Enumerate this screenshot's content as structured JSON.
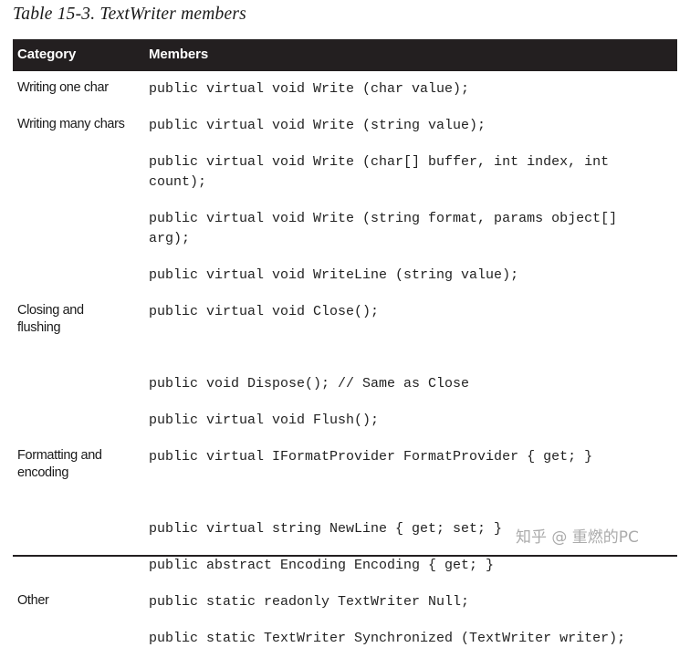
{
  "caption": "Table 15-3. TextWriter members",
  "table": {
    "headers": {
      "category": "Category",
      "members": "Members"
    },
    "rows": [
      {
        "category": "Writing one char",
        "members": "public virtual void Write (char value);"
      },
      {
        "category": "Writing many chars",
        "members": "public virtual void Write (string value);"
      },
      {
        "category": "",
        "members": "public virtual void Write (char[] buffer, int index, int\ncount);"
      },
      {
        "category": "",
        "members": "public virtual void Write (string format, params object[]\narg);"
      },
      {
        "category": "",
        "members": "public virtual void WriteLine (string value);"
      },
      {
        "category": "Closing and\nflushing",
        "members": "public virtual void Close();"
      },
      {
        "category": "",
        "members": "public void Dispose(); // Same as Close"
      },
      {
        "category": "",
        "members": "public virtual void Flush();"
      },
      {
        "category": "Formatting and\nencoding",
        "members": "public virtual IFormatProvider FormatProvider { get; }"
      },
      {
        "category": "",
        "members": "public virtual string NewLine { get; set; }"
      },
      {
        "category": "",
        "members": "public abstract Encoding Encoding { get; }"
      },
      {
        "category": "Other",
        "members": "public static readonly TextWriter Null;"
      },
      {
        "category": "",
        "members": "public static TextWriter Synchronized (TextWriter writer);"
      }
    ],
    "tall_row_indexes": [
      5,
      8
    ],
    "header_background": "#231f20",
    "text_color": "#222222"
  },
  "watermark": {
    "text": "知乎 @ 重燃的PC"
  }
}
